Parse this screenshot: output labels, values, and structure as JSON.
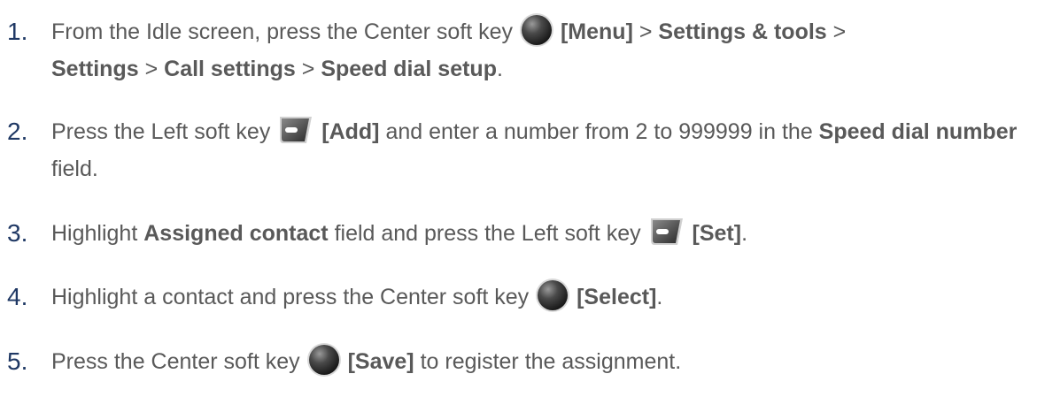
{
  "steps": [
    {
      "number": "1.",
      "t1": "From the Idle screen, press the Center soft key",
      "key": "[Menu]",
      "sep1": ">",
      "p1": "Settings & tools",
      "sep2": ">",
      "p2": "Settings",
      "sep3": ">",
      "p3": "Call settings",
      "sep4": ">",
      "p4": "Speed dial setup",
      "end": ".",
      "icon": "center-soft-key-icon"
    },
    {
      "number": "2.",
      "t1": "Press the Left soft key",
      "key": "[Add]",
      "t2": "and enter a number from 2 to 999999 in the",
      "b1": "Speed dial number",
      "t3": "field.",
      "icon": "left-soft-key-icon"
    },
    {
      "number": "3.",
      "t0": "Highlight",
      "b0": "Assigned contact",
      "t1": "field and press the Left soft key",
      "key": "[Set]",
      "end": ".",
      "icon": "left-soft-key-icon"
    },
    {
      "number": "4.",
      "t1": "Highlight a contact and press the Center soft key",
      "key": "[Select]",
      "end": ".",
      "icon": "center-soft-key-icon"
    },
    {
      "number": "5.",
      "t1": "Press the Center soft key",
      "key": "[Save]",
      "t2": "to register the assignment.",
      "icon": "center-soft-key-icon"
    }
  ],
  "colors": {
    "text": "#595959",
    "number": "#1f3864"
  }
}
